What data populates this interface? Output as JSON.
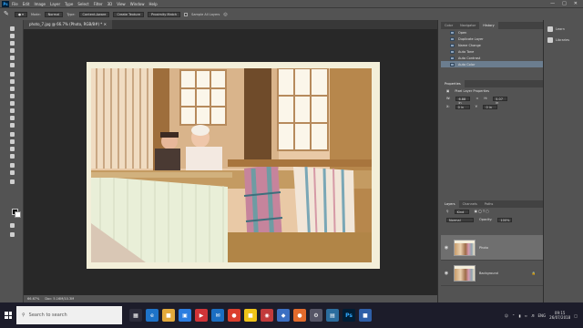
{
  "menu": {
    "app_badge": "Ps",
    "items": [
      "File",
      "Edit",
      "Image",
      "Layer",
      "Type",
      "Select",
      "Filter",
      "3D",
      "View",
      "Window",
      "Help"
    ]
  },
  "options_bar": {
    "mode_label": "Mode:",
    "mode_value": "Normal",
    "type_label": "Type:",
    "type_options": [
      "Content-Aware",
      "Create Texture",
      "Proximity Match"
    ],
    "sample_all_layers": "Sample All Layers"
  },
  "document": {
    "tab_title": "photo_7.jpg @ 66.7% (Photo, RGB/8#) *",
    "status_zoom": "66.67%",
    "status_doc": "Doc: 5.16M/10.3M"
  },
  "history_panel": {
    "tabs": [
      "Color",
      "Navigator",
      "History"
    ],
    "active_tab": "History",
    "items": [
      "Open",
      "Duplicate Layer",
      "Name Change",
      "Auto Tone",
      "Auto Contrast",
      "Auto Color"
    ],
    "selected_index": 5
  },
  "properties_panel": {
    "title": "Properties",
    "subtitle": "Pixel Layer Properties",
    "w_label": "W:",
    "w_value": "6.88 in",
    "h_label": "H:",
    "h_value": "5.07 in",
    "x_label": "X:",
    "x_value": "0 in",
    "y_label": "Y:",
    "y_value": "0 in"
  },
  "layers_panel": {
    "tabs": [
      "Layers",
      "Channels",
      "Paths"
    ],
    "active_tab": "Layers",
    "kind_label": "Kind",
    "blend_mode": "Normal",
    "opacity_label": "Opacity:",
    "opacity_value": "100%",
    "layers": [
      {
        "name": "Photo",
        "selected": true
      },
      {
        "name": "Background",
        "selected": false
      }
    ]
  },
  "libraries": {
    "items": [
      "Learn",
      "Libraries"
    ]
  },
  "taskbar": {
    "search_placeholder": "Search to search",
    "language": "ENG",
    "time": "09:15",
    "date": "26/07/2018"
  },
  "colors": {
    "ui_dark": "#535353",
    "canvas_bg": "#282828",
    "selection": "#6b7d8f",
    "photo_frame": "#f3efd9"
  }
}
